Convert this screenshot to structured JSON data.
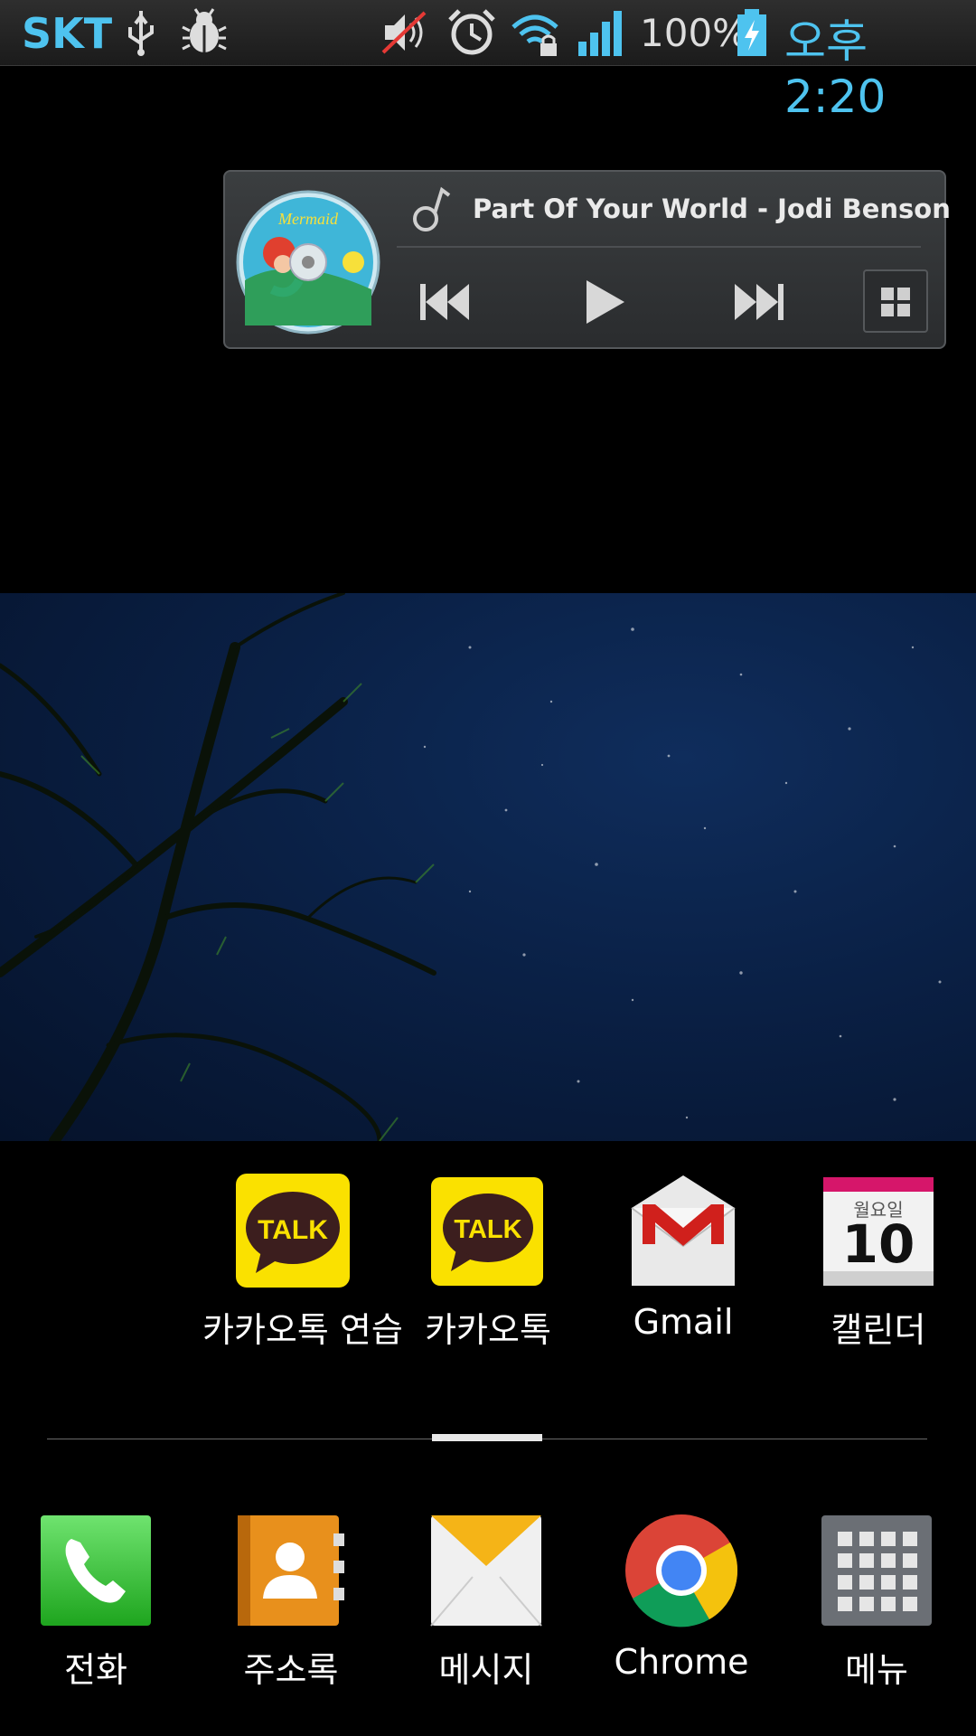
{
  "status_bar": {
    "carrier": "SKT",
    "battery_percent": "100%",
    "time": "오후 2:20",
    "icons": [
      "usb-icon",
      "bug-icon",
      "mute-icon",
      "alarm-icon",
      "wifi-lock-icon",
      "signal-icon",
      "battery-charging-icon"
    ]
  },
  "music_widget": {
    "song": "Part Of Your World - Jodi Benson",
    "controls": [
      "previous-icon",
      "play-icon",
      "next-icon",
      "widget-toggle-icon"
    ]
  },
  "home_apps": [
    {
      "label": "카카오톡 연습",
      "icon": "kakaotalk-icon"
    },
    {
      "label": "카카오톡",
      "icon": "kakaotalk-icon"
    },
    {
      "label": "Gmail",
      "icon": "gmail-icon"
    },
    {
      "label": "캘린더",
      "icon": "calendar-icon",
      "calendar_day": "월요일",
      "calendar_date": "10"
    }
  ],
  "dock": [
    {
      "label": "전화",
      "icon": "phone-icon"
    },
    {
      "label": "주소록",
      "icon": "contacts-icon"
    },
    {
      "label": "메시지",
      "icon": "message-icon"
    },
    {
      "label": "Chrome",
      "icon": "chrome-icon"
    },
    {
      "label": "메뉴",
      "icon": "apps-menu-icon"
    }
  ],
  "colors": {
    "status_accent": "#4ec3ef",
    "kakao_yellow": "#fae100",
    "gmail_red": "#d0201c",
    "phone_green": "#3fc53f"
  }
}
